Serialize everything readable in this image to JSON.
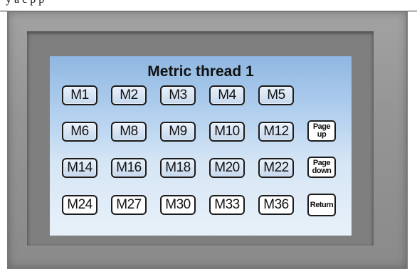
{
  "caption": "  y     a c   p   p  ",
  "screen": {
    "title": "Metric thread 1",
    "rows": [
      [
        "M1",
        "M2",
        "M3",
        "M4",
        "M5"
      ],
      [
        "M6",
        "M8",
        "M9",
        "M10",
        "M12"
      ],
      [
        "M14",
        "M16",
        "M18",
        "M20",
        "M22"
      ],
      [
        "M24",
        "M27",
        "M30",
        "M33",
        "M36"
      ]
    ],
    "page_up": [
      "Page",
      "up"
    ],
    "page_down": [
      "Page",
      "down"
    ],
    "return_label": "Return"
  },
  "colors": {
    "bezel": "#959595",
    "screen_top": "#8fb7e2",
    "screen_bottom": "#e8f1f9",
    "button_border": "#1b1b1b"
  }
}
